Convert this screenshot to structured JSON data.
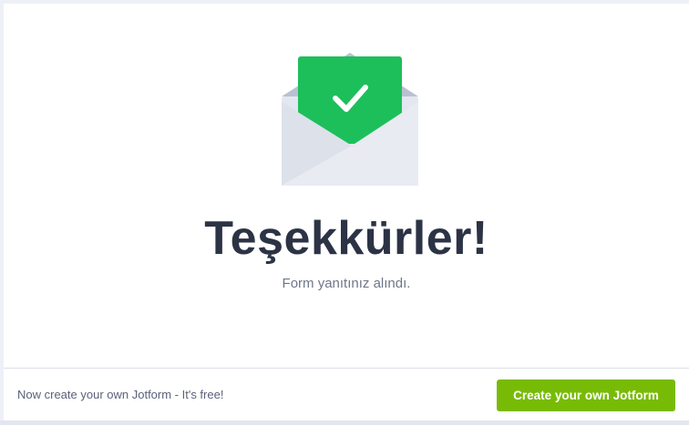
{
  "confirmation": {
    "title": "Teşekkürler!",
    "message": "Form yanıtınız alındı.",
    "icon": "envelope-check-icon"
  },
  "footer": {
    "promo_text": "Now create your own Jotform - It's free!",
    "cta_label": "Create your own Jotform"
  },
  "colors": {
    "accent_green": "#1dbf5b",
    "cta_green": "#78bb07",
    "title_text": "#2c3345",
    "background": "#eef0f7"
  }
}
